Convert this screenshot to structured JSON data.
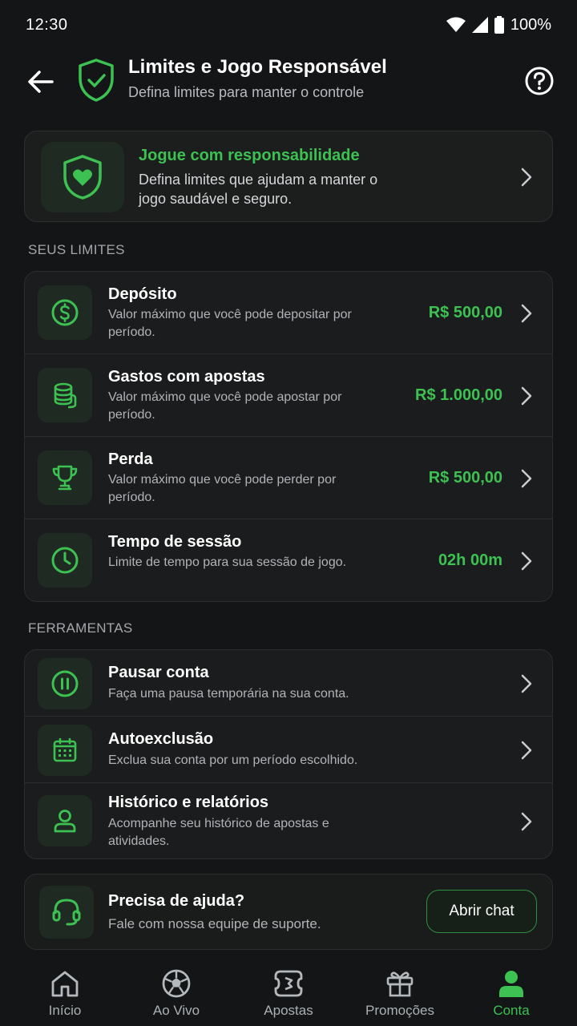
{
  "status_bar": {
    "time": "12:30",
    "battery": "100%"
  },
  "header": {
    "title": "Limites e Jogo Responsável",
    "subtitle": "Defina limites para manter o controle"
  },
  "banner": {
    "title": "Jogue com responsabilidade",
    "text": "Defina limites que ajudam a manter o jogo saudável e seguro."
  },
  "limits_section": {
    "label": "SEUS LIMITES",
    "items": [
      {
        "title": "Depósito",
        "description": "Valor máximo que você pode depositar por período.",
        "value": "R$ 500,00",
        "icon": "dollar-icon"
      },
      {
        "title": "Gastos com apostas",
        "description": "Valor máximo que você pode apostar por período.",
        "value": "R$ 1.000,00",
        "icon": "coins-icon"
      },
      {
        "title": "Perda",
        "description": "Valor máximo que você pode perder por período.",
        "value": "R$ 500,00",
        "icon": "trophy-icon"
      },
      {
        "title": "Tempo de sessão",
        "description": "Limite de tempo para sua sessão de jogo.",
        "value": "02h 00m",
        "icon": "clock-icon"
      }
    ]
  },
  "tools_section": {
    "label": "FERRAMENTAS",
    "items": [
      {
        "title": "Pausar conta",
        "description": "Faça uma pausa temporária na sua conta.",
        "icon": "pause-icon"
      },
      {
        "title": "Autoexclusão",
        "description": "Exclua sua conta por um período escolhido.",
        "icon": "calendar-icon"
      },
      {
        "title": "Histórico e relatórios",
        "description": "Acompanhe seu histórico de apostas e atividades.",
        "icon": "user-icon"
      }
    ]
  },
  "help": {
    "title": "Precisa de ajuda?",
    "description": "Fale com nossa equipe de suporte.",
    "button": "Abrir chat"
  },
  "bottom_nav": {
    "items": [
      {
        "label": "Início",
        "icon": "home-icon"
      },
      {
        "label": "Ao Vivo",
        "icon": "soccer-ball-icon"
      },
      {
        "label": "Apostas",
        "icon": "ticket-icon"
      },
      {
        "label": "Promoções",
        "icon": "gift-icon"
      },
      {
        "label": "Conta",
        "icon": "account-icon",
        "active": true
      }
    ]
  },
  "colors": {
    "accent": "#3cc152",
    "background": "#141516",
    "card": "#1b1c1d"
  }
}
